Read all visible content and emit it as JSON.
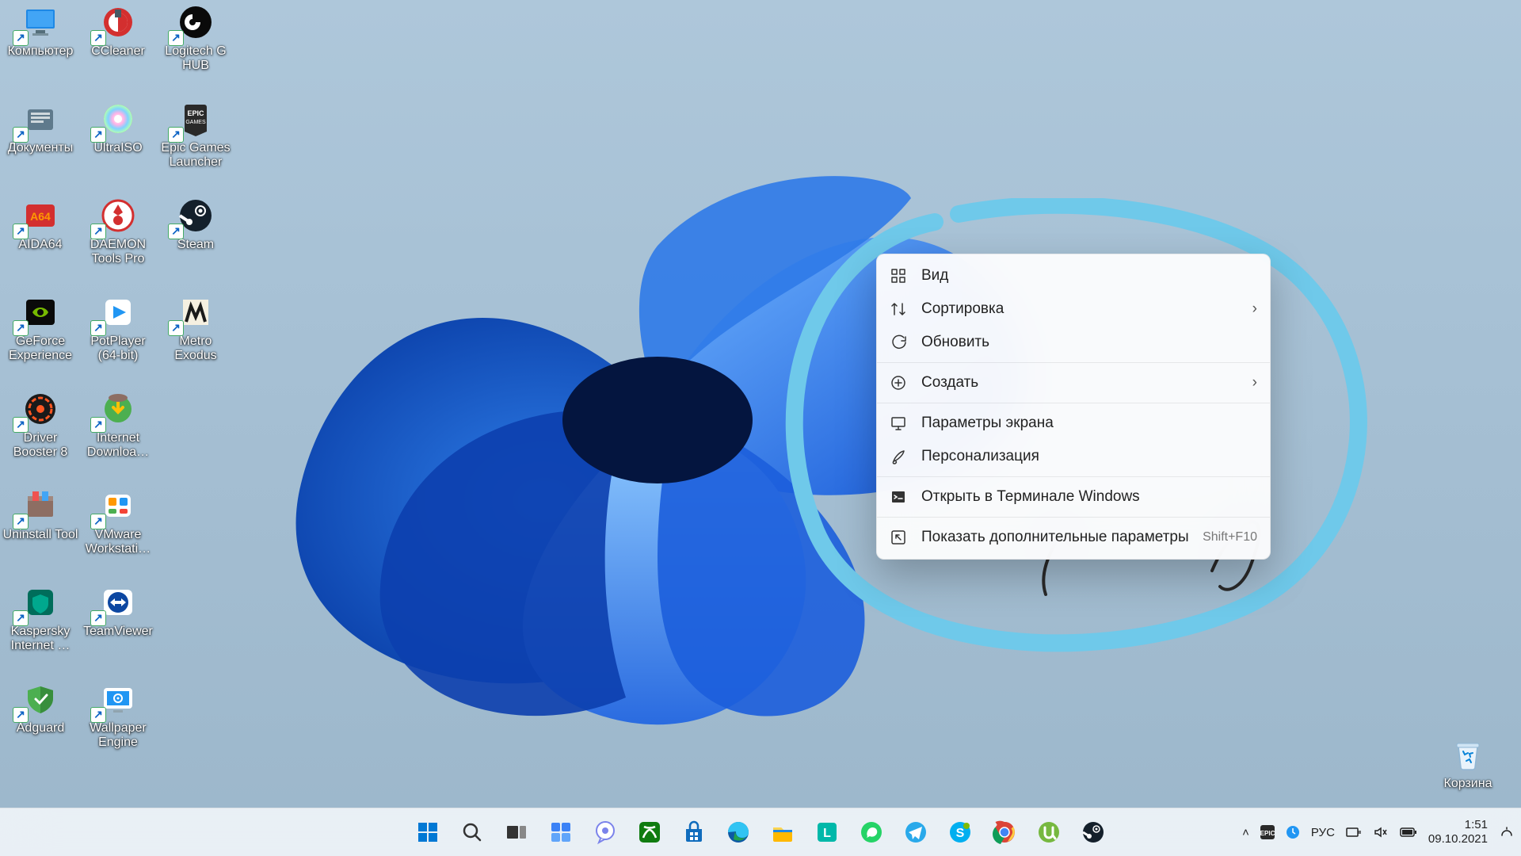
{
  "desktop_icons": [
    {
      "label": "Компьютер",
      "row": 0,
      "col": 0,
      "kind": "computer",
      "shortcut": true
    },
    {
      "label": "CCleaner",
      "row": 0,
      "col": 1,
      "kind": "ccleaner",
      "shortcut": true
    },
    {
      "label": "Logitech G HUB",
      "row": 0,
      "col": 2,
      "kind": "logitech",
      "shortcut": true
    },
    {
      "label": "Документы",
      "row": 1,
      "col": 0,
      "kind": "documents",
      "shortcut": true
    },
    {
      "label": "UltraISO",
      "row": 1,
      "col": 1,
      "kind": "ultraiso",
      "shortcut": true
    },
    {
      "label": "Epic Games Launcher",
      "row": 1,
      "col": 2,
      "kind": "epic",
      "shortcut": true
    },
    {
      "label": "AIDA64",
      "row": 2,
      "col": 0,
      "kind": "aida",
      "shortcut": true
    },
    {
      "label": "DAEMON Tools Pro",
      "row": 2,
      "col": 1,
      "kind": "daemon",
      "shortcut": true
    },
    {
      "label": "Steam",
      "row": 2,
      "col": 2,
      "kind": "steam",
      "shortcut": true
    },
    {
      "label": "GeForce Experience",
      "row": 3,
      "col": 0,
      "kind": "geforce",
      "shortcut": true
    },
    {
      "label": "PotPlayer (64-bit)",
      "row": 3,
      "col": 1,
      "kind": "potplayer",
      "shortcut": true
    },
    {
      "label": "Metro Exodus",
      "row": 3,
      "col": 2,
      "kind": "metro",
      "shortcut": true
    },
    {
      "label": "Driver Booster 8",
      "row": 4,
      "col": 0,
      "kind": "driverbooster",
      "shortcut": true
    },
    {
      "label": "Internet Downloa…",
      "row": 4,
      "col": 1,
      "kind": "idm",
      "shortcut": true
    },
    {
      "label": "Uninstall Tool",
      "row": 5,
      "col": 0,
      "kind": "uninstall",
      "shortcut": true
    },
    {
      "label": "VMware Workstati…",
      "row": 5,
      "col": 1,
      "kind": "vmware",
      "shortcut": true
    },
    {
      "label": "Kaspersky Internet …",
      "row": 6,
      "col": 0,
      "kind": "kaspersky",
      "shortcut": true
    },
    {
      "label": "TeamViewer",
      "row": 6,
      "col": 1,
      "kind": "teamviewer",
      "shortcut": true
    },
    {
      "label": "Adguard",
      "row": 7,
      "col": 0,
      "kind": "adguard",
      "shortcut": true
    },
    {
      "label": "Wallpaper Engine",
      "row": 7,
      "col": 1,
      "kind": "wallpaper",
      "shortcut": true
    }
  ],
  "recycle_bin": {
    "label": "Корзина"
  },
  "context_menu": {
    "items": [
      {
        "icon": "grid",
        "label": "Вид",
        "submenu": false
      },
      {
        "icon": "sort",
        "label": "Сортировка",
        "submenu": true
      },
      {
        "icon": "refresh",
        "label": "Обновить",
        "submenu": false
      },
      "sep",
      {
        "icon": "plus",
        "label": "Создать",
        "submenu": true
      },
      "sep",
      {
        "icon": "display",
        "label": "Параметры экрана",
        "submenu": false
      },
      {
        "icon": "brush",
        "label": "Персонализация",
        "submenu": false
      },
      "sep",
      {
        "icon": "terminal",
        "label": "Открыть в Терминале Windows",
        "submenu": false
      },
      "sep",
      {
        "icon": "more",
        "label": "Показать дополнительные параметры",
        "shortcut": "Shift+F10",
        "submenu": false
      }
    ]
  },
  "taskbar": {
    "buttons": [
      "start",
      "search",
      "taskview",
      "widgets",
      "chat",
      "xbox",
      "msstore",
      "edge",
      "explorer",
      "librera",
      "whatsapp",
      "telegram",
      "skype",
      "chrome",
      "utorrent",
      "steam"
    ]
  },
  "systray": {
    "overflow": "▴",
    "lang": "РУС",
    "time": "1:51",
    "date": "09.10.2021"
  },
  "colors": {
    "accent": "#0078d4",
    "annotation": "#6fc9ea"
  }
}
